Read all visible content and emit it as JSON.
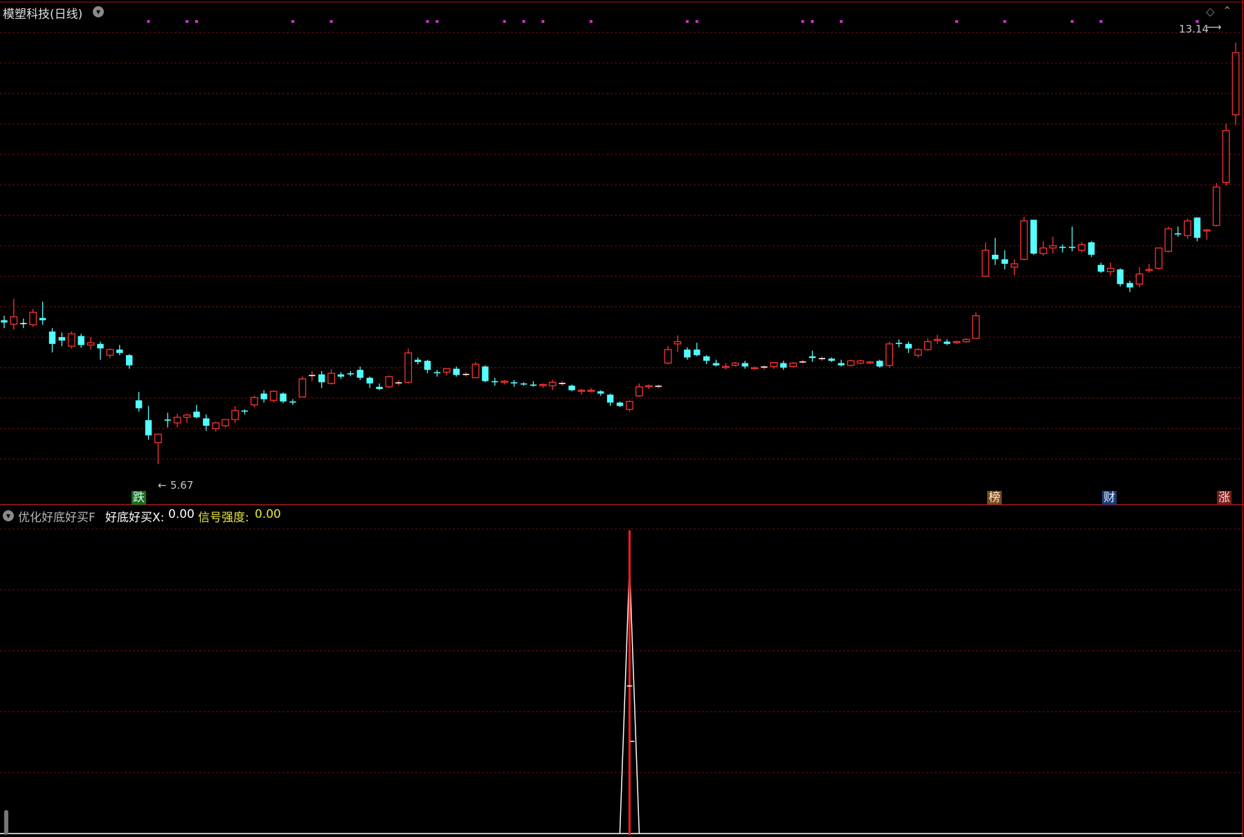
{
  "title": "模塑科技(日线)",
  "sub_indicator": {
    "name": "优化好底好买F",
    "line1_label": "好底好买X:",
    "line1_value": "0.00",
    "line2_label": "信号强度:",
    "line2_value": "0.00"
  },
  "price_labels": {
    "high": "13.14",
    "low": "5.67"
  },
  "event_tags": {
    "fall": "跌",
    "rank": "榜",
    "finance": "财",
    "rise": "涨"
  },
  "colors": {
    "up": "#ff3232",
    "down": "#54ffff",
    "grid": "#7a1010",
    "magenta_marker": "#cc33cc",
    "signal_line": "#ff2020",
    "indicator_line": "#ffffff",
    "label_yellow": "#e8e840"
  },
  "icons": {
    "title_menu": "chevron-down-icon",
    "sub_menu": "chevron-down-icon",
    "corner": "diamond-icon"
  },
  "chart_data": [
    {
      "type": "candlestick",
      "title": "模塑科技(日线)",
      "xlabel": "",
      "ylabel": "",
      "ylim": [
        5.0,
        13.6
      ],
      "grid": true,
      "annotations": [
        {
          "text": "13.14",
          "bar": 128,
          "value": 13.14
        },
        {
          "text": "5.67",
          "bar": 16,
          "value": 5.67
        }
      ],
      "magenta_markers_bars": [
        15,
        19,
        20,
        30,
        34,
        44,
        45,
        52,
        54,
        56,
        61,
        71,
        72,
        83,
        84,
        87,
        99,
        104,
        111,
        114,
        124
      ],
      "ohlc": [
        [
          8.22,
          8.3,
          8.08,
          8.18
        ],
        [
          8.15,
          8.6,
          8.05,
          8.28
        ],
        [
          8.16,
          8.25,
          8.08,
          8.15
        ],
        [
          8.14,
          8.42,
          8.1,
          8.36
        ],
        [
          8.26,
          8.55,
          8.14,
          8.22
        ],
        [
          8.02,
          8.08,
          7.65,
          7.8
        ],
        [
          7.92,
          8.0,
          7.76,
          7.86
        ],
        [
          7.76,
          8.02,
          7.72,
          7.98
        ],
        [
          7.94,
          7.98,
          7.73,
          7.78
        ],
        [
          7.78,
          7.92,
          7.7,
          7.82
        ],
        [
          7.8,
          7.84,
          7.52,
          7.72
        ],
        [
          7.6,
          7.72,
          7.55,
          7.7
        ],
        [
          7.7,
          7.78,
          7.6,
          7.64
        ],
        [
          7.6,
          7.62,
          7.36,
          7.42
        ],
        [
          6.8,
          6.95,
          6.6,
          6.66
        ],
        [
          6.45,
          6.7,
          6.1,
          6.18
        ],
        [
          6.05,
          6.2,
          5.67,
          6.2
        ],
        [
          6.46,
          6.58,
          6.32,
          6.44
        ],
        [
          6.4,
          6.56,
          6.32,
          6.5
        ],
        [
          6.5,
          6.56,
          6.4,
          6.54
        ],
        [
          6.6,
          6.72,
          6.48,
          6.5
        ],
        [
          6.48,
          6.55,
          6.26,
          6.35
        ],
        [
          6.3,
          6.42,
          6.25,
          6.4
        ],
        [
          6.35,
          6.46,
          6.32,
          6.46
        ],
        [
          6.46,
          6.7,
          6.4,
          6.62
        ],
        [
          6.62,
          6.64,
          6.55,
          6.6
        ],
        [
          6.72,
          6.88,
          6.68,
          6.85
        ],
        [
          6.92,
          6.98,
          6.76,
          6.82
        ],
        [
          6.8,
          6.98,
          6.76,
          6.96
        ],
        [
          6.92,
          6.94,
          6.75,
          6.78
        ],
        [
          6.78,
          6.82,
          6.72,
          6.76
        ],
        [
          6.86,
          7.22,
          6.86,
          7.18
        ],
        [
          7.24,
          7.32,
          7.14,
          7.24
        ],
        [
          7.26,
          7.32,
          7.02,
          7.12
        ],
        [
          7.1,
          7.35,
          7.08,
          7.28
        ],
        [
          7.26,
          7.3,
          7.18,
          7.22
        ],
        [
          7.28,
          7.32,
          7.23,
          7.26
        ],
        [
          7.34,
          7.4,
          7.16,
          7.2
        ],
        [
          7.2,
          7.22,
          7.02,
          7.1
        ],
        [
          7.04,
          7.1,
          6.98,
          7.0
        ],
        [
          7.04,
          7.24,
          7.02,
          7.22
        ],
        [
          7.1,
          7.16,
          7.06,
          7.11
        ],
        [
          7.12,
          7.72,
          7.1,
          7.64
        ],
        [
          7.52,
          7.56,
          7.44,
          7.48
        ],
        [
          7.5,
          7.52,
          7.28,
          7.34
        ],
        [
          7.3,
          7.34,
          7.22,
          7.28
        ],
        [
          7.3,
          7.34,
          7.24,
          7.36
        ],
        [
          7.36,
          7.4,
          7.22,
          7.25
        ],
        [
          7.26,
          7.3,
          7.22,
          7.26
        ],
        [
          7.2,
          7.48,
          7.2,
          7.44
        ],
        [
          7.4,
          7.42,
          7.12,
          7.14
        ],
        [
          7.14,
          7.2,
          7.06,
          7.12
        ],
        [
          7.12,
          7.16,
          7.08,
          7.14
        ],
        [
          7.12,
          7.16,
          7.04,
          7.1
        ],
        [
          7.1,
          7.12,
          7.06,
          7.08
        ],
        [
          7.08,
          7.14,
          7.04,
          7.06
        ],
        [
          7.06,
          7.1,
          7.02,
          7.08
        ],
        [
          7.06,
          7.16,
          6.98,
          7.12
        ],
        [
          7.1,
          7.14,
          7.06,
          7.1
        ],
        [
          7.06,
          7.08,
          6.96,
          6.98
        ],
        [
          6.96,
          7.0,
          6.9,
          6.98
        ],
        [
          6.96,
          7.02,
          6.94,
          6.98
        ],
        [
          6.96,
          6.98,
          6.88,
          6.92
        ],
        [
          6.9,
          6.92,
          6.7,
          6.76
        ],
        [
          6.76,
          6.78,
          6.68,
          6.7
        ],
        [
          6.64,
          6.8,
          6.6,
          6.78
        ],
        [
          6.88,
          7.1,
          6.86,
          7.04
        ],
        [
          7.04,
          7.08,
          7.0,
          7.06
        ],
        [
          7.04,
          7.08,
          7.01,
          7.05
        ],
        [
          7.46,
          7.76,
          7.44,
          7.7
        ],
        [
          7.8,
          7.95,
          7.66,
          7.84
        ],
        [
          7.7,
          7.74,
          7.52,
          7.56
        ],
        [
          7.7,
          7.82,
          7.58,
          7.6
        ],
        [
          7.58,
          7.6,
          7.44,
          7.5
        ],
        [
          7.46,
          7.52,
          7.4,
          7.42
        ],
        [
          7.38,
          7.46,
          7.35,
          7.4
        ],
        [
          7.42,
          7.48,
          7.4,
          7.46
        ],
        [
          7.46,
          7.5,
          7.36,
          7.4
        ],
        [
          7.36,
          7.4,
          7.34,
          7.38
        ],
        [
          7.38,
          7.42,
          7.34,
          7.39
        ],
        [
          7.4,
          7.48,
          7.36,
          7.47
        ],
        [
          7.46,
          7.5,
          7.34,
          7.38
        ],
        [
          7.4,
          7.48,
          7.38,
          7.46
        ],
        [
          7.48,
          7.52,
          7.46,
          7.48
        ],
        [
          7.58,
          7.68,
          7.48,
          7.55
        ],
        [
          7.54,
          7.58,
          7.5,
          7.54
        ],
        [
          7.54,
          7.56,
          7.48,
          7.5
        ],
        [
          7.46,
          7.52,
          7.4,
          7.42
        ],
        [
          7.42,
          7.52,
          7.4,
          7.5
        ],
        [
          7.46,
          7.52,
          7.44,
          7.5
        ],
        [
          7.46,
          7.5,
          7.44,
          7.48
        ],
        [
          7.5,
          7.52,
          7.38,
          7.4
        ],
        [
          7.42,
          7.84,
          7.38,
          7.8
        ],
        [
          7.82,
          7.88,
          7.74,
          7.8
        ],
        [
          7.8,
          7.84,
          7.64,
          7.72
        ],
        [
          7.6,
          7.72,
          7.56,
          7.7
        ],
        [
          7.7,
          7.9,
          7.68,
          7.84
        ],
        [
          7.86,
          7.96,
          7.8,
          7.88
        ],
        [
          7.84,
          7.88,
          7.78,
          7.8
        ],
        [
          7.82,
          7.86,
          7.8,
          7.84
        ],
        [
          7.84,
          7.9,
          7.82,
          7.88
        ],
        [
          7.9,
          8.36,
          7.9,
          8.3
        ],
        [
          9.0,
          9.6,
          8.98,
          9.46
        ],
        [
          9.38,
          9.68,
          9.2,
          9.3
        ],
        [
          9.3,
          9.46,
          9.12,
          9.22
        ],
        [
          9.16,
          9.3,
          9.02,
          9.22
        ],
        [
          9.3,
          10.05,
          9.28,
          9.98
        ],
        [
          10.0,
          10.0,
          9.38,
          9.4
        ],
        [
          9.4,
          9.62,
          9.36,
          9.5
        ],
        [
          9.5,
          9.7,
          9.4,
          9.54
        ],
        [
          9.52,
          9.56,
          9.42,
          9.5
        ],
        [
          9.52,
          9.88,
          9.44,
          9.5
        ],
        [
          9.46,
          9.6,
          9.42,
          9.56
        ],
        [
          9.6,
          9.62,
          9.34,
          9.38
        ],
        [
          9.2,
          9.24,
          9.06,
          9.08
        ],
        [
          9.08,
          9.24,
          9.02,
          9.14
        ],
        [
          9.12,
          9.14,
          8.82,
          8.86
        ],
        [
          8.88,
          8.92,
          8.72,
          8.8
        ],
        [
          8.86,
          9.16,
          8.8,
          9.04
        ],
        [
          9.1,
          9.22,
          9.06,
          9.12
        ],
        [
          9.14,
          9.5,
          9.12,
          9.5
        ],
        [
          9.44,
          9.88,
          9.42,
          9.84
        ],
        [
          9.76,
          9.88,
          9.7,
          9.74
        ],
        [
          9.72,
          10.02,
          9.66,
          9.98
        ],
        [
          10.04,
          10.04,
          9.62,
          9.68
        ],
        [
          9.8,
          9.84,
          9.64,
          9.82
        ],
        [
          9.9,
          10.65,
          9.88,
          10.58
        ],
        [
          10.66,
          11.7,
          10.6,
          11.58
        ],
        [
          11.86,
          13.14,
          11.68,
          12.96
        ]
      ]
    },
    {
      "type": "line",
      "title": "优化好底好买F",
      "series": [
        {
          "name": "好底好买X",
          "spike_bar": 65,
          "values": [
            0.0,
            1.0,
            0.0
          ]
        },
        {
          "name": "信号强度",
          "spike_bar": 65,
          "values": [
            0.0,
            1.0,
            0.0
          ]
        }
      ],
      "ylim": [
        0.0,
        1.0
      ],
      "grid": true
    }
  ]
}
